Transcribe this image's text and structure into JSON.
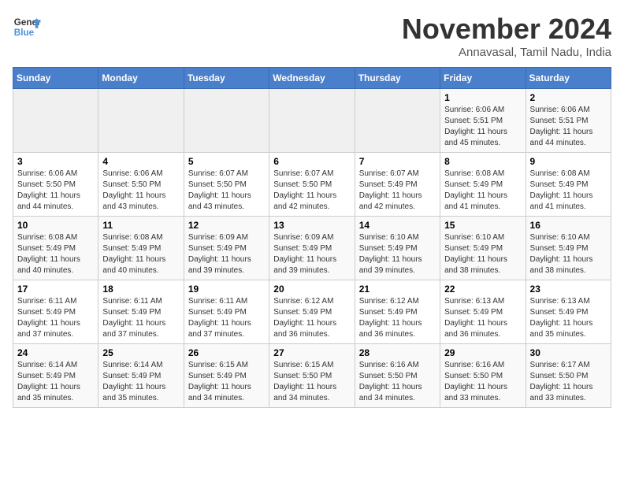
{
  "header": {
    "logo_line1": "General",
    "logo_line2": "Blue",
    "month_title": "November 2024",
    "location": "Annavasal, Tamil Nadu, India"
  },
  "weekdays": [
    "Sunday",
    "Monday",
    "Tuesday",
    "Wednesday",
    "Thursday",
    "Friday",
    "Saturday"
  ],
  "weeks": [
    [
      {
        "day": "",
        "info": ""
      },
      {
        "day": "",
        "info": ""
      },
      {
        "day": "",
        "info": ""
      },
      {
        "day": "",
        "info": ""
      },
      {
        "day": "",
        "info": ""
      },
      {
        "day": "1",
        "info": "Sunrise: 6:06 AM\nSunset: 5:51 PM\nDaylight: 11 hours and 45 minutes."
      },
      {
        "day": "2",
        "info": "Sunrise: 6:06 AM\nSunset: 5:51 PM\nDaylight: 11 hours and 44 minutes."
      }
    ],
    [
      {
        "day": "3",
        "info": "Sunrise: 6:06 AM\nSunset: 5:50 PM\nDaylight: 11 hours and 44 minutes."
      },
      {
        "day": "4",
        "info": "Sunrise: 6:06 AM\nSunset: 5:50 PM\nDaylight: 11 hours and 43 minutes."
      },
      {
        "day": "5",
        "info": "Sunrise: 6:07 AM\nSunset: 5:50 PM\nDaylight: 11 hours and 43 minutes."
      },
      {
        "day": "6",
        "info": "Sunrise: 6:07 AM\nSunset: 5:50 PM\nDaylight: 11 hours and 42 minutes."
      },
      {
        "day": "7",
        "info": "Sunrise: 6:07 AM\nSunset: 5:49 PM\nDaylight: 11 hours and 42 minutes."
      },
      {
        "day": "8",
        "info": "Sunrise: 6:08 AM\nSunset: 5:49 PM\nDaylight: 11 hours and 41 minutes."
      },
      {
        "day": "9",
        "info": "Sunrise: 6:08 AM\nSunset: 5:49 PM\nDaylight: 11 hours and 41 minutes."
      }
    ],
    [
      {
        "day": "10",
        "info": "Sunrise: 6:08 AM\nSunset: 5:49 PM\nDaylight: 11 hours and 40 minutes."
      },
      {
        "day": "11",
        "info": "Sunrise: 6:08 AM\nSunset: 5:49 PM\nDaylight: 11 hours and 40 minutes."
      },
      {
        "day": "12",
        "info": "Sunrise: 6:09 AM\nSunset: 5:49 PM\nDaylight: 11 hours and 39 minutes."
      },
      {
        "day": "13",
        "info": "Sunrise: 6:09 AM\nSunset: 5:49 PM\nDaylight: 11 hours and 39 minutes."
      },
      {
        "day": "14",
        "info": "Sunrise: 6:10 AM\nSunset: 5:49 PM\nDaylight: 11 hours and 39 minutes."
      },
      {
        "day": "15",
        "info": "Sunrise: 6:10 AM\nSunset: 5:49 PM\nDaylight: 11 hours and 38 minutes."
      },
      {
        "day": "16",
        "info": "Sunrise: 6:10 AM\nSunset: 5:49 PM\nDaylight: 11 hours and 38 minutes."
      }
    ],
    [
      {
        "day": "17",
        "info": "Sunrise: 6:11 AM\nSunset: 5:49 PM\nDaylight: 11 hours and 37 minutes."
      },
      {
        "day": "18",
        "info": "Sunrise: 6:11 AM\nSunset: 5:49 PM\nDaylight: 11 hours and 37 minutes."
      },
      {
        "day": "19",
        "info": "Sunrise: 6:11 AM\nSunset: 5:49 PM\nDaylight: 11 hours and 37 minutes."
      },
      {
        "day": "20",
        "info": "Sunrise: 6:12 AM\nSunset: 5:49 PM\nDaylight: 11 hours and 36 minutes."
      },
      {
        "day": "21",
        "info": "Sunrise: 6:12 AM\nSunset: 5:49 PM\nDaylight: 11 hours and 36 minutes."
      },
      {
        "day": "22",
        "info": "Sunrise: 6:13 AM\nSunset: 5:49 PM\nDaylight: 11 hours and 36 minutes."
      },
      {
        "day": "23",
        "info": "Sunrise: 6:13 AM\nSunset: 5:49 PM\nDaylight: 11 hours and 35 minutes."
      }
    ],
    [
      {
        "day": "24",
        "info": "Sunrise: 6:14 AM\nSunset: 5:49 PM\nDaylight: 11 hours and 35 minutes."
      },
      {
        "day": "25",
        "info": "Sunrise: 6:14 AM\nSunset: 5:49 PM\nDaylight: 11 hours and 35 minutes."
      },
      {
        "day": "26",
        "info": "Sunrise: 6:15 AM\nSunset: 5:49 PM\nDaylight: 11 hours and 34 minutes."
      },
      {
        "day": "27",
        "info": "Sunrise: 6:15 AM\nSunset: 5:50 PM\nDaylight: 11 hours and 34 minutes."
      },
      {
        "day": "28",
        "info": "Sunrise: 6:16 AM\nSunset: 5:50 PM\nDaylight: 11 hours and 34 minutes."
      },
      {
        "day": "29",
        "info": "Sunrise: 6:16 AM\nSunset: 5:50 PM\nDaylight: 11 hours and 33 minutes."
      },
      {
        "day": "30",
        "info": "Sunrise: 6:17 AM\nSunset: 5:50 PM\nDaylight: 11 hours and 33 minutes."
      }
    ]
  ]
}
